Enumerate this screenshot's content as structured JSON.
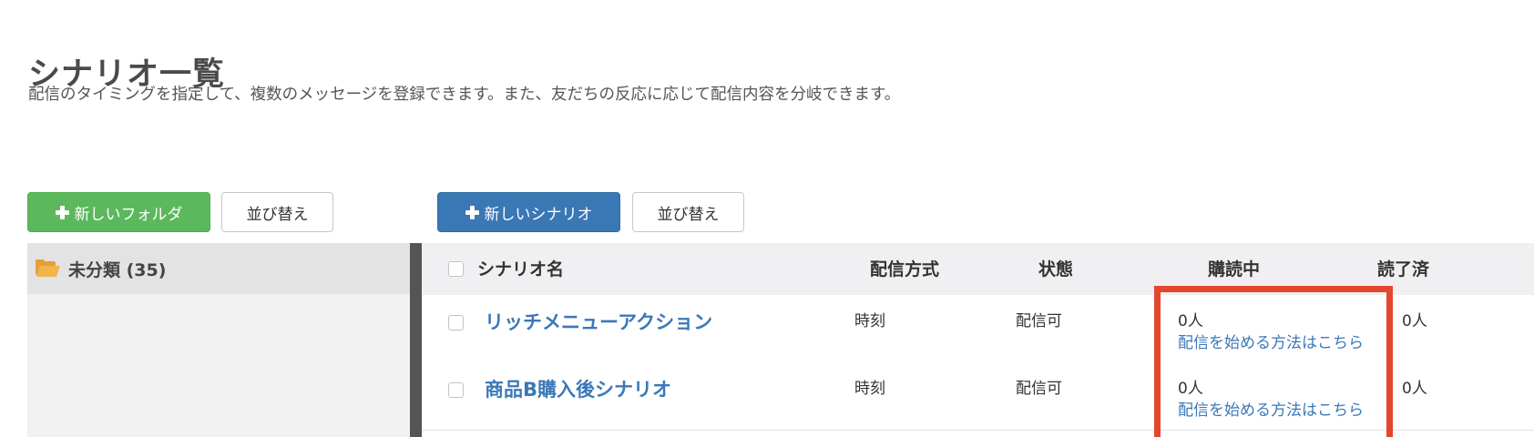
{
  "page": {
    "title": "シナリオ一覧",
    "description": "配信のタイミングを指定して、複数のメッセージを登録できます。また、友だちの反応に応じて配信内容を分岐できます。"
  },
  "toolbar": {
    "new_folder_label": "新しいフォルダ",
    "sort_folders_label": "並び替え",
    "new_scenario_label": "新しいシナリオ",
    "sort_scenarios_label": "並び替え"
  },
  "folders": [
    {
      "label": "未分類 (35)",
      "icon": "folder-open-icon"
    }
  ],
  "table": {
    "headers": {
      "name": "シナリオ名",
      "method": "配信方式",
      "status": "状態",
      "subscribing": "購読中",
      "completed": "読了済"
    },
    "rows": [
      {
        "name": "リッチメニューアクション",
        "method": "時刻",
        "status": "配信可",
        "subscribing": "0人",
        "subscribing_link": "配信を始める方法はこちら",
        "completed": "0人"
      },
      {
        "name": "商品B購入後シナリオ",
        "method": "時刻",
        "status": "配信可",
        "subscribing": "0人",
        "subscribing_link": "配信を始める方法はこちら",
        "completed": "0人"
      }
    ]
  },
  "colors": {
    "green_button": "#5cb85c",
    "blue_button": "#3a77b5",
    "link": "#3b78b8",
    "highlight": "#e4462e"
  }
}
